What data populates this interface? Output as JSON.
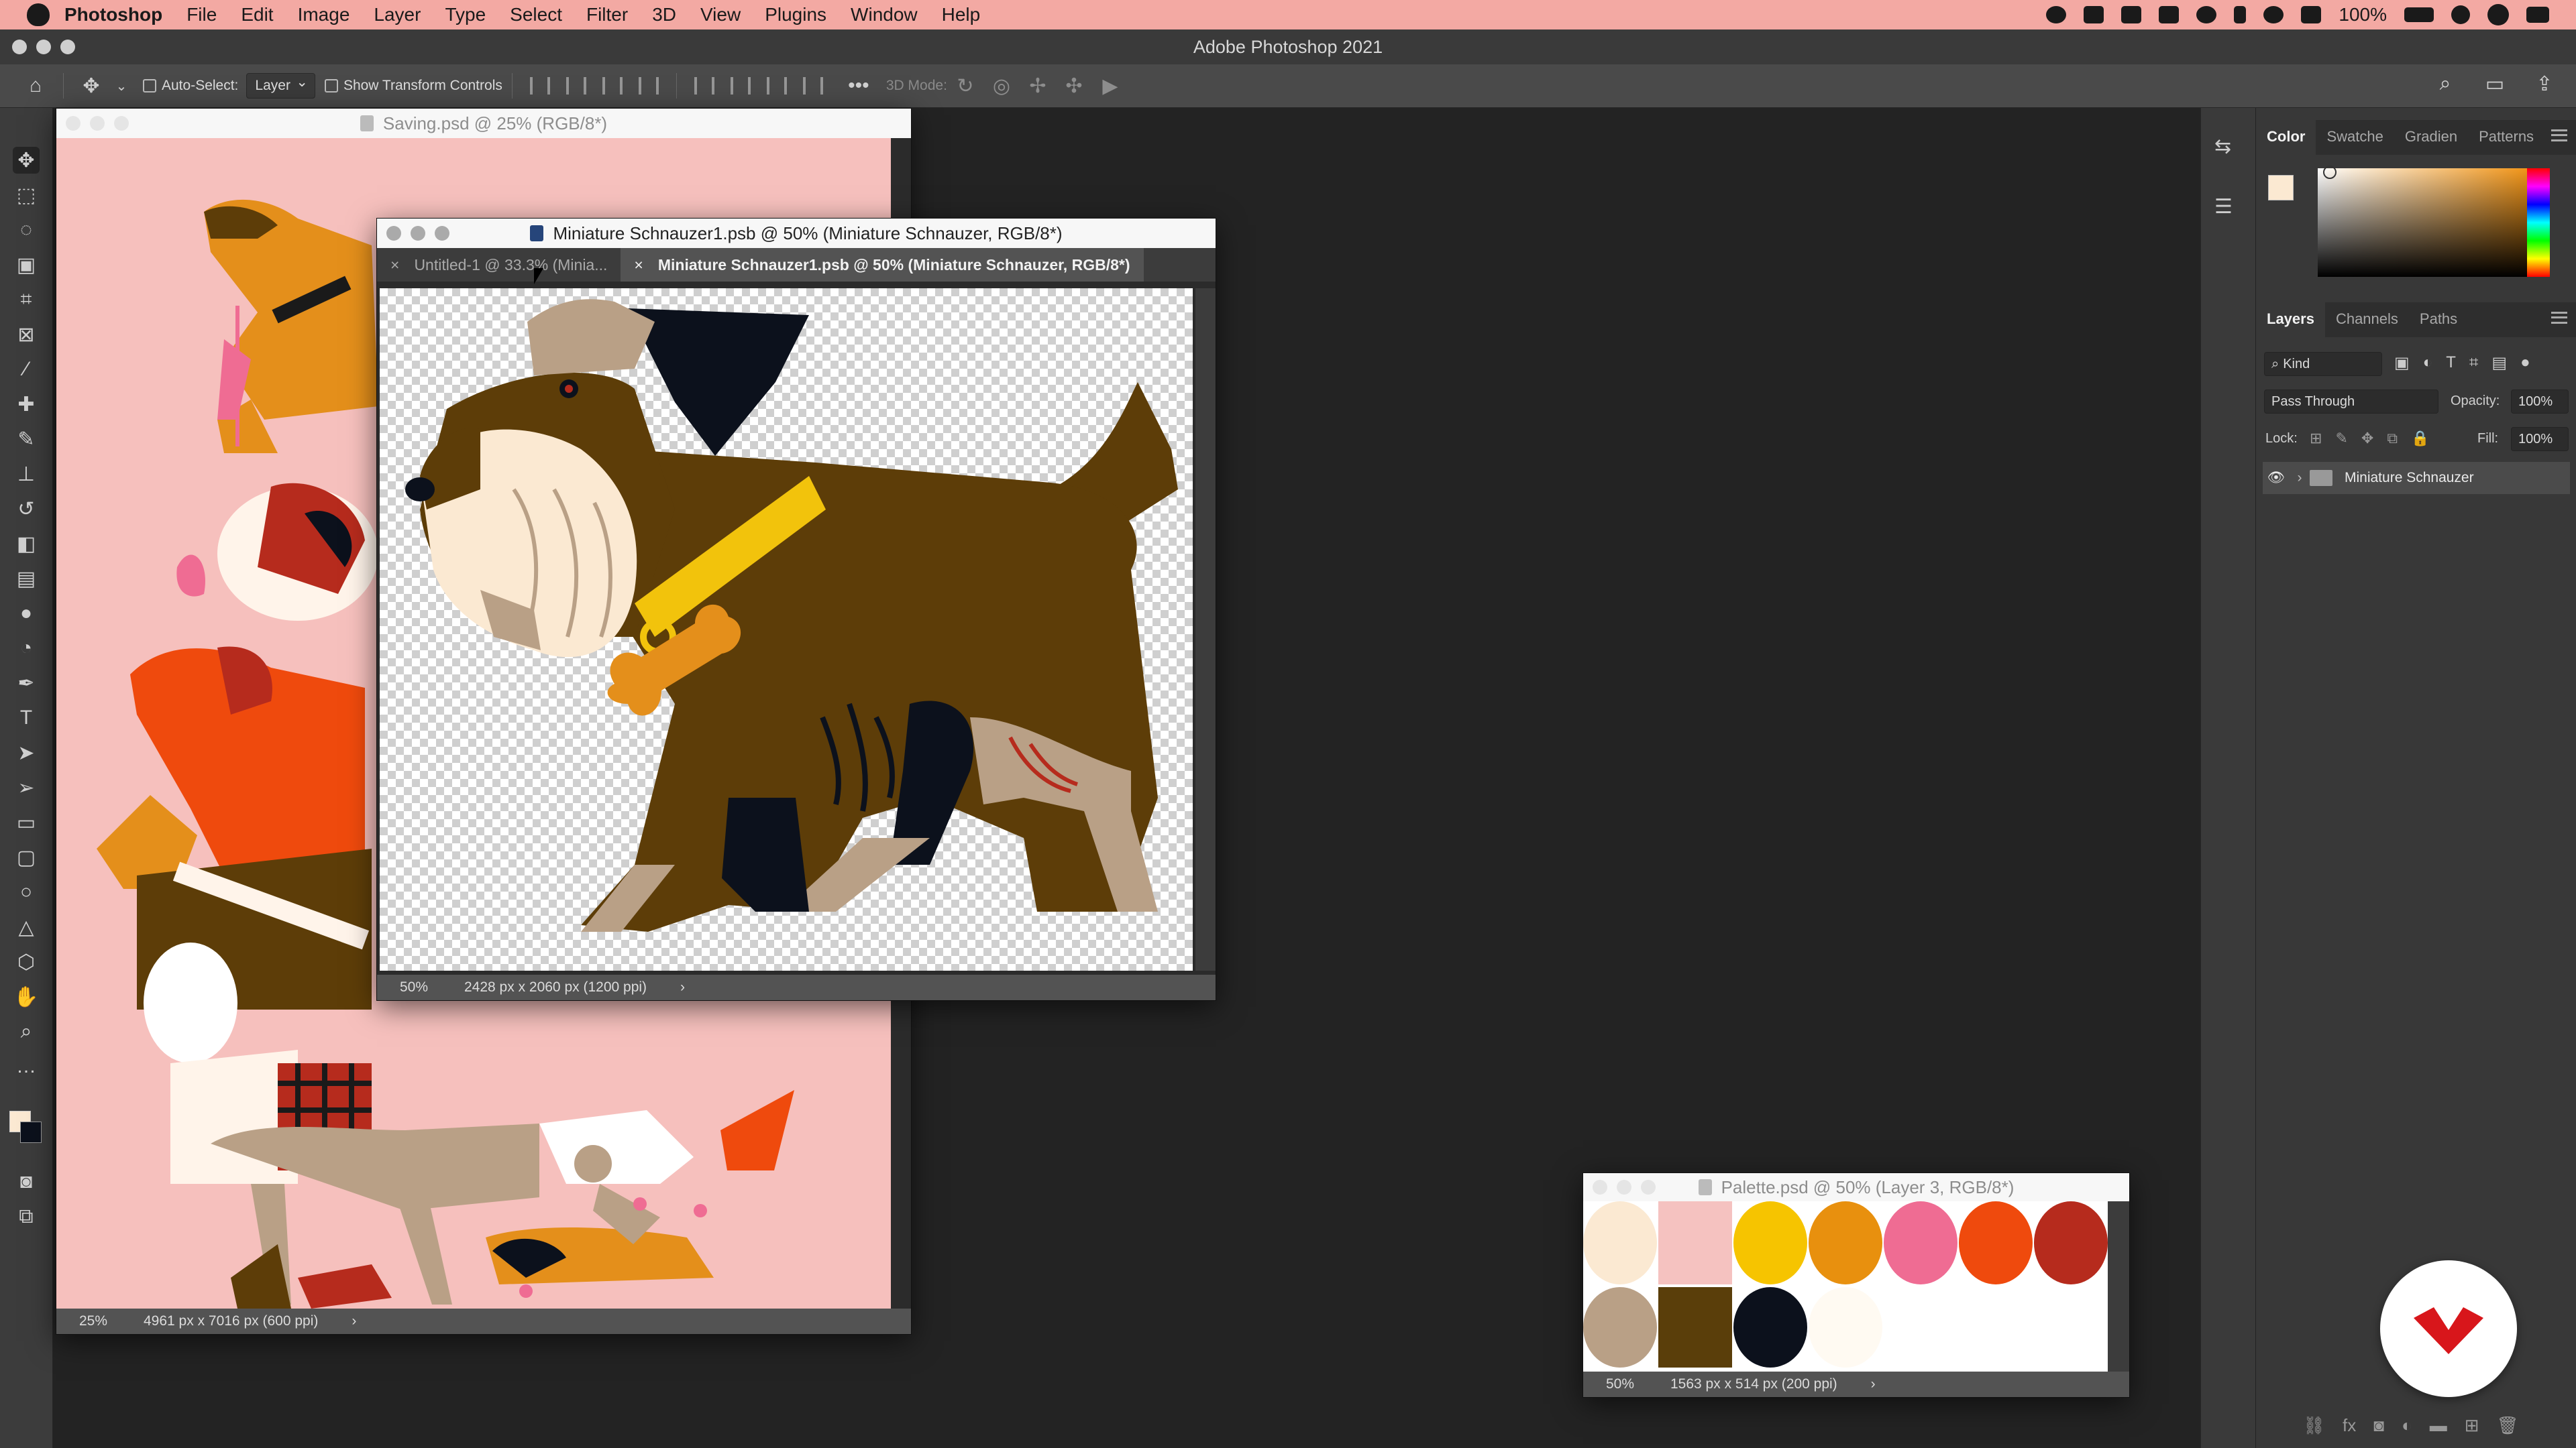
{
  "menubar": {
    "items": [
      "Photoshop",
      "File",
      "Edit",
      "Image",
      "Layer",
      "Type",
      "Select",
      "Filter",
      "3D",
      "View",
      "Plugins",
      "Window",
      "Help"
    ],
    "battery": "100%"
  },
  "app": {
    "title": "Adobe Photoshop 2021"
  },
  "options_bar": {
    "auto_select_label": "Auto-Select:",
    "auto_select_value": "Layer",
    "transform_label": "Show Transform Controls",
    "mode_3d_label": "3D Mode:"
  },
  "docs": {
    "saving": {
      "title": "Saving.psd @ 25% (RGB/8*)",
      "zoom": "25%",
      "info": "4961 px x 7016 px (600 ppi)"
    },
    "schnauzer": {
      "title": "Miniature Schnauzer1.psb @ 50% (Miniature Schnauzer, RGB/8*)",
      "tabs": [
        "Untitled-1 @ 33.3% (Minia...",
        "Miniature Schnauzer1.psb @ 50% (Miniature Schnauzer, RGB/8*)"
      ],
      "zoom": "50%",
      "info": "2428 px x 2060 px (1200 ppi)"
    },
    "palette": {
      "title": "Palette.psd @ 50% (Layer 3, RGB/8*)",
      "zoom": "50%",
      "info": "1563 px x 514 px (200 ppi)",
      "colors_top": [
        "#fbe9d2",
        "#f5c2c0",
        "#f6c400",
        "#e8900e",
        "#ef6c93",
        "#ef4a0d",
        "#b62b1d"
      ],
      "colors_bottom": [
        "#b9a086",
        "#5a3e0a",
        "#0c111c",
        "#fffaf2"
      ]
    }
  },
  "color_panel": {
    "tabs": [
      "Color",
      "Swatche",
      "Gradien",
      "Patterns"
    ]
  },
  "layers_panel": {
    "tabs": [
      "Layers",
      "Channels",
      "Paths"
    ],
    "kind_label": "Kind",
    "blend_mode": "Pass Through",
    "opacity_label": "Opacity:",
    "opacity_value": "100%",
    "lock_label": "Lock:",
    "fill_label": "Fill:",
    "fill_value": "100%",
    "layers": [
      {
        "name": "Miniature Schnauzer"
      }
    ]
  },
  "colors": {
    "menubar_bg": "#f3a9a3",
    "canvas_pink": "#f6c0bd",
    "dog_brown": "#5d3d08",
    "collar_yellow": "#f2c30c",
    "bone_orange": "#e48f1b",
    "brand_red": "#d8161b"
  }
}
